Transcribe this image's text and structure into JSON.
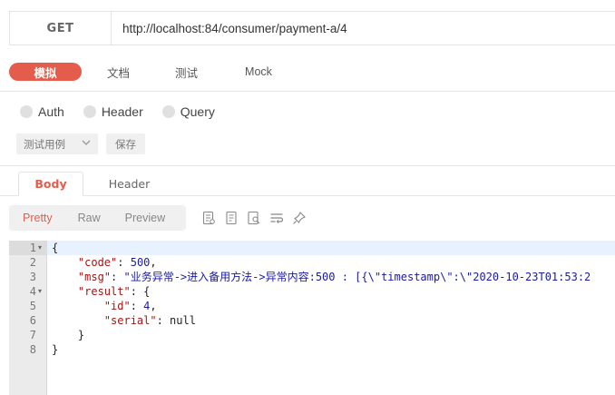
{
  "request": {
    "method": "GET",
    "url": "http://localhost:84/consumer/payment-a/4"
  },
  "mode_tabs": [
    "模拟",
    "文档",
    "测试",
    "Mock"
  ],
  "auth_options": [
    "Auth",
    "Header",
    "Query"
  ],
  "case_select": {
    "label": "测试用例",
    "icon": "chevron-down-icon"
  },
  "save_label": "保存",
  "response_tabs": [
    "Body",
    "Header"
  ],
  "view_modes": [
    "Pretty",
    "Raw",
    "Preview"
  ],
  "tool_icons": [
    "document-icon",
    "copy-icon",
    "search-doc-icon",
    "wrap-lines-icon",
    "pin-icon"
  ],
  "editor": {
    "line_numbers": [
      "1",
      "2",
      "3",
      "4",
      "5",
      "6",
      "7",
      "8"
    ],
    "lines": {
      "l1_brace": "{",
      "l2_key": "\"code\"",
      "l2_sep": ": ",
      "l2_val": "500",
      "l2_end": ",",
      "l3_key": "\"msg\"",
      "l3_sep": ": ",
      "l3_val": "\"业务异常->进入备用方法->异常内容:500 : [{\\\"timestamp\\\":\\\"2020-10-23T01:53:2",
      "l4_key": "\"result\"",
      "l4_sep": ": {",
      "l5_key": "\"id\"",
      "l5_sep": ": ",
      "l5_val": "4",
      "l5_end": ",",
      "l6_key": "\"serial\"",
      "l6_sep": ": ",
      "l6_val": "null",
      "l7_brace": "}",
      "l8_brace": "}"
    }
  },
  "colors": {
    "accent": "#e45c4c",
    "json_key": "#a31515",
    "json_value": "#1a1aa6",
    "active_line": "#e8f2fe"
  }
}
